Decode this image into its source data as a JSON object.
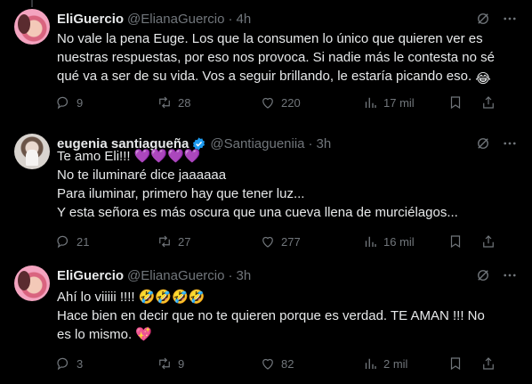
{
  "tweets": [
    {
      "name": "EliGuercio",
      "handle": "@ElianaGuercio",
      "time": "4h",
      "lines": [
        "No vale la pena Euge. Los que la consumen lo único que quieren ver es nuestras respuestas, por eso nos provoca. Si nadie más le contesta no sé qué va a ser de su vida. Vos a seguir brillando, le estaría picando eso."
      ],
      "emoji_end": "😂",
      "replies": "9",
      "reposts": "28",
      "likes": "220",
      "views": "17 mil"
    },
    {
      "name": "eugenia santiagueña",
      "handle": "@Santiagueniia",
      "time": "3h",
      "lines": [
        "Te amo Eli!!! 💜💜💜💜",
        "No te iluminaré dice jaaaaaa",
        "Para iluminar, primero hay que tener luz...",
        "Y esta señora es más oscura que una cueva llena de murciélagos..."
      ],
      "replies": "21",
      "reposts": "27",
      "likes": "277",
      "views": "16 mil"
    },
    {
      "name": "EliGuercio",
      "handle": "@ElianaGuercio",
      "time": "3h",
      "lines": [
        "Ahí lo viiiii !!!! 🤣🤣🤣🤣",
        "Hace bien en decir que no te quieren porque es verdad. TE AMAN !!! No es lo mismo. 💖"
      ],
      "replies": "3",
      "reposts": "9",
      "likes": "82",
      "views": "2 mil"
    }
  ],
  "colors": {
    "background": "#000000",
    "text": "#e7e9ea",
    "muted": "#71767b",
    "verified": "#1d9bf0",
    "thread_line": "#333639"
  },
  "icons": [
    "grok-icon",
    "more-icon",
    "reply-icon",
    "repost-icon",
    "like-icon",
    "views-icon",
    "bookmark-icon",
    "share-icon",
    "verified-badge-icon"
  ]
}
